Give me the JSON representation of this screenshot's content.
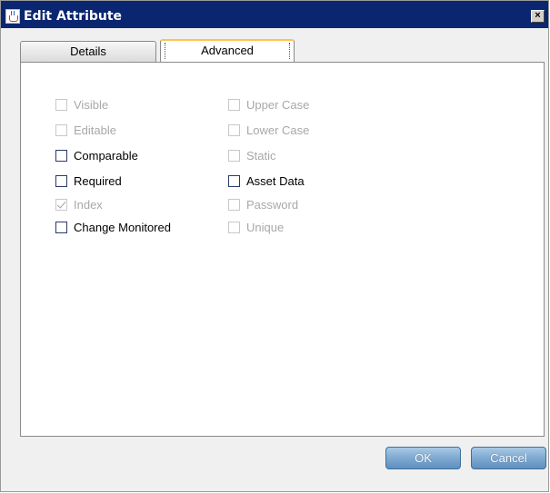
{
  "window": {
    "title": "Edit Attribute",
    "close_symbol": "×"
  },
  "tabs": [
    {
      "label": "Details",
      "selected": false
    },
    {
      "label": "Advanced",
      "selected": true
    }
  ],
  "checkboxes_left": [
    {
      "label": "Visible",
      "checked": false,
      "enabled": false
    },
    {
      "label": "Editable",
      "checked": false,
      "enabled": false
    },
    {
      "label": "Comparable",
      "checked": false,
      "enabled": true
    },
    {
      "label": "Required",
      "checked": false,
      "enabled": true
    },
    {
      "label": "Index",
      "checked": true,
      "enabled": false
    },
    {
      "label": "Change Monitored",
      "checked": false,
      "enabled": true
    }
  ],
  "checkboxes_right": [
    {
      "label": "Upper Case",
      "checked": false,
      "enabled": false
    },
    {
      "label": "Lower Case",
      "checked": false,
      "enabled": false
    },
    {
      "label": "Static",
      "checked": false,
      "enabled": false
    },
    {
      "label": "Asset Data",
      "checked": false,
      "enabled": true
    },
    {
      "label": "Password",
      "checked": false,
      "enabled": false
    },
    {
      "label": "Unique",
      "checked": false,
      "enabled": false
    }
  ],
  "buttons": {
    "ok_label": "OK",
    "cancel_label": "Cancel"
  },
  "colors": {
    "titlebar": "#0b2670",
    "selected_tab_accent": "#ffc34d",
    "button_blue": "#7ea9d1"
  }
}
